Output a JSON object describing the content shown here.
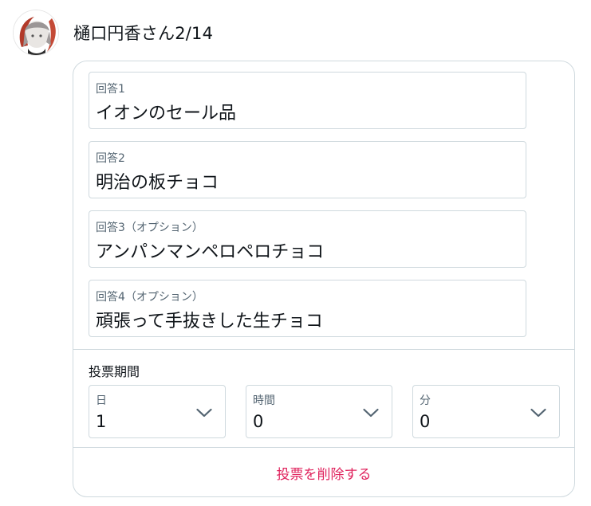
{
  "author": {
    "name": "樋口円香さん2/14"
  },
  "poll": {
    "choices": [
      {
        "label": "回答1",
        "value": "イオンのセール品"
      },
      {
        "label": "回答2",
        "value": "明治の板チョコ"
      },
      {
        "label": "回答3（オプション）",
        "value": "アンパンマンペロペロチョコ"
      },
      {
        "label": "回答4（オプション）",
        "value": "頑張って手抜きした生チョコ"
      }
    ],
    "length": {
      "title": "投票期間",
      "days": {
        "label": "日",
        "value": "1"
      },
      "hours": {
        "label": "時間",
        "value": "0"
      },
      "minutes": {
        "label": "分",
        "value": "0"
      }
    },
    "remove_label": "投票を削除する"
  },
  "colors": {
    "border": "#cfd9de",
    "label": "#536471",
    "text": "#0f1419",
    "danger": "#e0245e",
    "chevron": "#536471"
  },
  "icons": {
    "chevron": "chevron-down-icon",
    "avatar": "user-avatar"
  }
}
